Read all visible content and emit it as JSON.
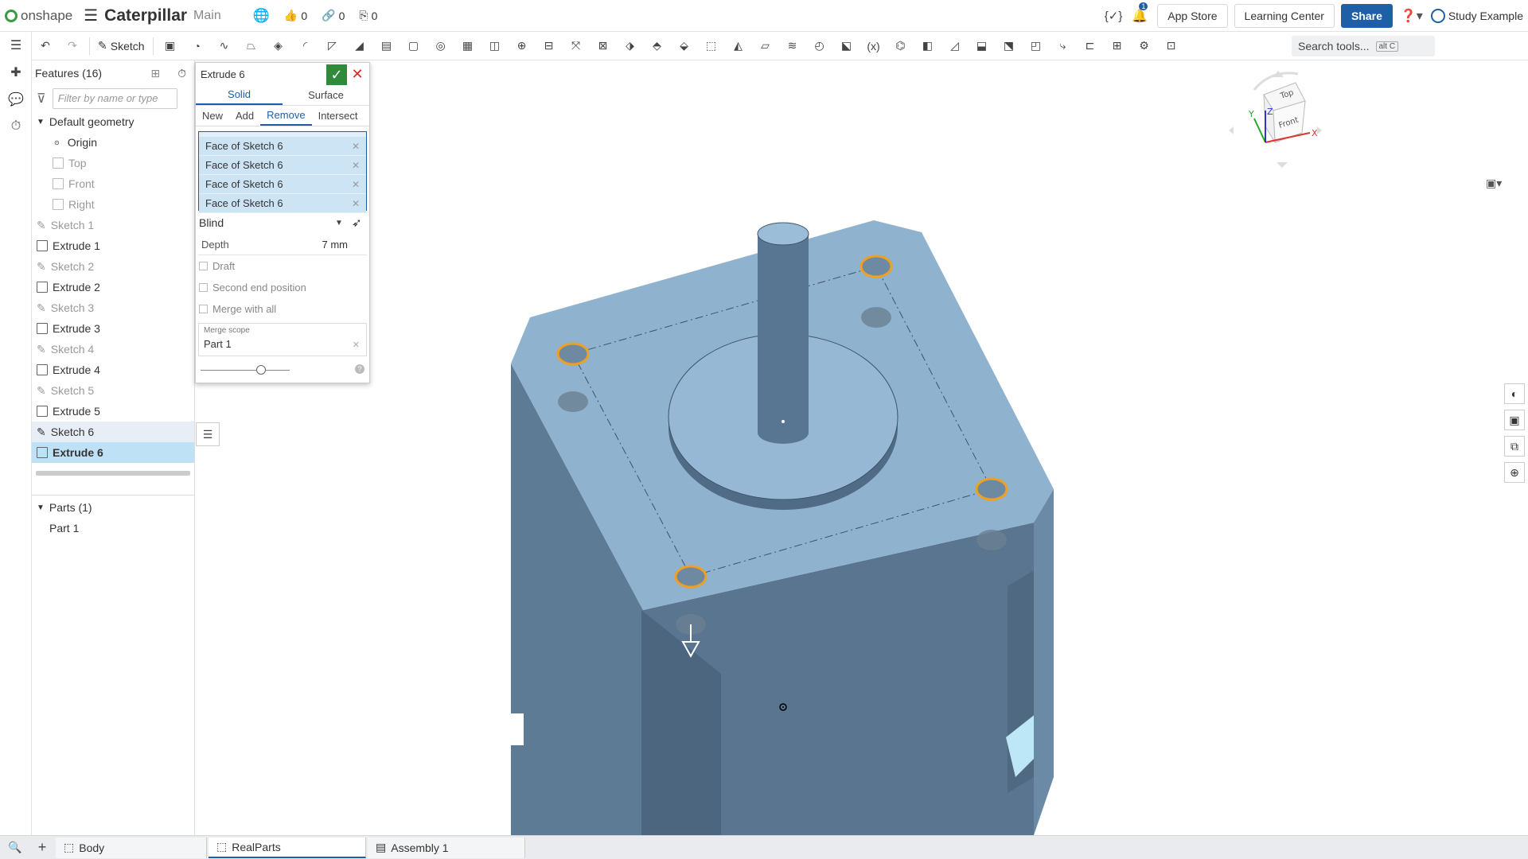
{
  "app": {
    "logo_text": "onshape",
    "doc_title": "Caterpillar",
    "branch": "Main"
  },
  "counters": {
    "likes": "0",
    "links": "0",
    "copies": "0"
  },
  "topbar": {
    "notif_count": "1",
    "app_store": "App Store",
    "learning_center": "Learning Center",
    "share": "Share",
    "user": "Study Example"
  },
  "toolbar": {
    "sketch_label": "Sketch",
    "search_placeholder": "Search tools...",
    "search_kbd": "alt C"
  },
  "features": {
    "header": "Features (16)",
    "filter_placeholder": "Filter by name or type",
    "default_geometry": "Default geometry",
    "geometry_items": [
      "Origin",
      "Top",
      "Front",
      "Right"
    ],
    "items": [
      "Sketch 1",
      "Extrude 1",
      "Sketch 2",
      "Extrude 2",
      "Sketch 3",
      "Extrude 3",
      "Sketch 4",
      "Extrude 4",
      "Sketch 5",
      "Extrude 5",
      "Sketch 6",
      "Extrude 6"
    ],
    "parts_header": "Parts (1)",
    "parts": [
      "Part 1"
    ]
  },
  "dialog": {
    "title": "Extrude 6",
    "type_tabs": [
      "Solid",
      "Surface"
    ],
    "op_tabs": [
      "New",
      "Add",
      "Remove",
      "Intersect"
    ],
    "selections": [
      "Face of Sketch 6",
      "Face of Sketch 6",
      "Face of Sketch 6",
      "Face of Sketch 6"
    ],
    "end_type": "Blind",
    "depth_label": "Depth",
    "depth_value": "7 mm",
    "options": [
      "Draft",
      "Second end position",
      "Merge with all"
    ],
    "merge_scope_label": "Merge scope",
    "merge_scope_value": "Part 1"
  },
  "viewcube": {
    "top": "Top",
    "front": "Front",
    "x": "X",
    "y": "Y",
    "z": "Z"
  },
  "bottom_tabs": [
    "Body",
    "RealParts",
    "Assembly 1"
  ],
  "colors": {
    "accent": "#1f5fa8",
    "body_top": "#8fb0cc",
    "body_side": "#5b7791",
    "highlight": "#f0a020",
    "confirm": "#2e8b3a"
  }
}
